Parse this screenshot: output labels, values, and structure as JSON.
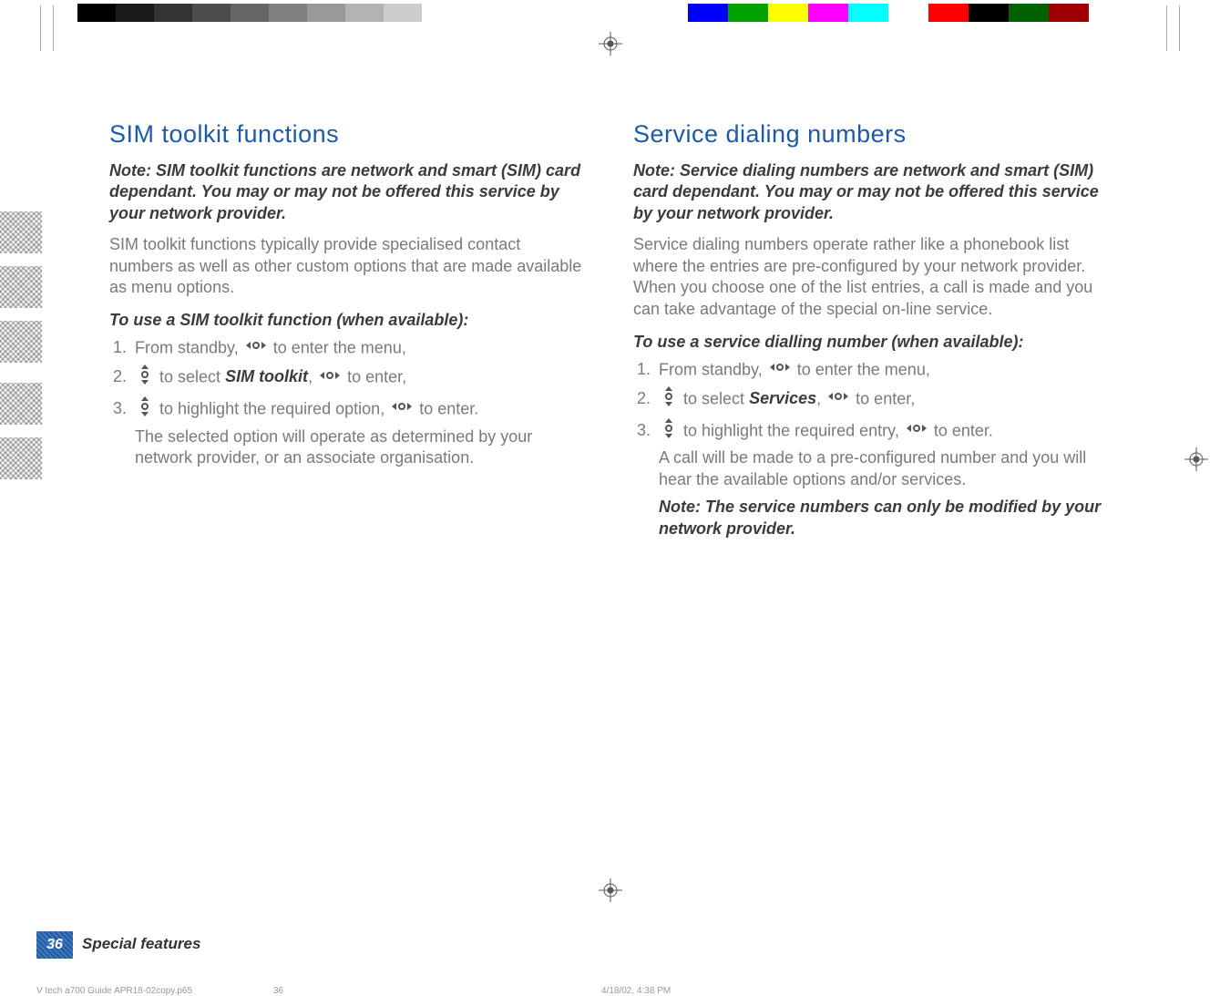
{
  "left": {
    "heading": "SIM toolkit functions",
    "note": "Note: SIM toolkit functions are network and smart (SIM) card dependant. You may or may not be offered this service by your network provider.",
    "body": "SIM toolkit functions typically provide specialised contact numbers as well as other custom options that are made available as menu options.",
    "task": "To use a SIM toolkit function (when available):",
    "steps": [
      {
        "pre": "From standby, ",
        "icon": "h",
        "post": " to enter the menu,"
      },
      {
        "pre": "",
        "icon": "v",
        "post_a": " to select ",
        "kw": "SIM toolkit",
        "post_b": ", ",
        "icon2": "h",
        "post_c": " to enter,"
      },
      {
        "pre": "",
        "icon": "v",
        "post_a": " to highlight the required option, ",
        "icon2": "h",
        "post_c": " to enter."
      }
    ],
    "result": "The selected option will operate as determined by your network provider, or an associate organisation."
  },
  "right": {
    "heading": "Service dialing numbers",
    "note": "Note: Service dialing numbers are network and smart (SIM) card dependant. You may or may not be offered this service by your network provider.",
    "body": "Service dialing numbers operate rather like a phonebook list where the entries are pre-configured by your network provider. When you choose one of the list entries, a call is made and you can take advantage of the special on-line service.",
    "task": "To use a service dialling number (when available):",
    "steps": [
      {
        "pre": "From standby, ",
        "icon": "h",
        "post": " to enter the menu,"
      },
      {
        "pre": "",
        "icon": "v",
        "post_a": " to select ",
        "kw": "Services",
        "post_b": ", ",
        "icon2": "h",
        "post_c": " to enter,"
      },
      {
        "pre": "",
        "icon": "v",
        "post_a": " to highlight the required entry, ",
        "icon2": "h",
        "post_c": " to enter."
      }
    ],
    "result": "A call will be made to a pre-configured number and you will hear the available options and/or services.",
    "result_note": "Note: The service numbers can only be modified by your network provider."
  },
  "footer": {
    "page_number": "36",
    "section": "Special features",
    "file": "V tech a700 Guide APR18-02copy.p65",
    "sheet": "36",
    "timestamp": "4/18/02, 4:38 PM"
  },
  "calibration": {
    "grays": [
      "#000000",
      "#1a1a1a",
      "#333333",
      "#4d4d4d",
      "#666666",
      "#808080",
      "#999999",
      "#b3b3b3",
      "#cccccc",
      "#ffffff"
    ],
    "colors": [
      "#0000ff",
      "#00a000",
      "#ffff00",
      "#ff00ff",
      "#00ffff",
      "#ffffff",
      "#ff0000",
      "#000000",
      "#006000",
      "#a00000"
    ]
  }
}
